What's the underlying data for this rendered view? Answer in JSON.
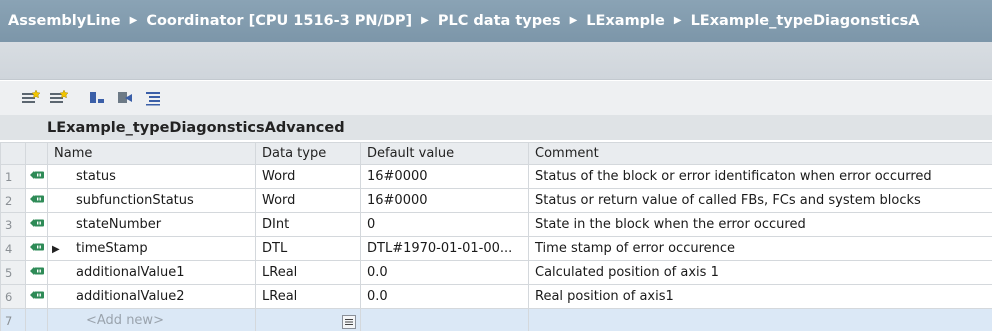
{
  "breadcrumb": {
    "items": [
      "AssemblyLine",
      "Coordinator [CPU 1516-3 PN/DP]",
      "PLC data types",
      "LExample",
      "LExample_typeDiagonsticsA"
    ],
    "separator": "▶"
  },
  "toolbar": {
    "buttons": [
      {
        "icon": "insert-row-icon"
      },
      {
        "icon": "add-row-icon"
      },
      {
        "icon": "expand-all-icon"
      },
      {
        "icon": "collapse-all-icon"
      },
      {
        "icon": "list-view-icon"
      }
    ]
  },
  "struct": {
    "title": "LExample_typeDiagonsticsAdvanced"
  },
  "table": {
    "columns": [
      "Name",
      "Data type",
      "Default value",
      "Comment"
    ],
    "rows": [
      {
        "num": "1",
        "name": "status",
        "type": "Word",
        "default": "16#0000",
        "comment": "Status of the block or error identificaton when error occurred",
        "expandable": false
      },
      {
        "num": "2",
        "name": "subfunctionStatus",
        "type": "Word",
        "default": "16#0000",
        "comment": "Status or return value of called FBs, FCs and system blocks",
        "expandable": false
      },
      {
        "num": "3",
        "name": "stateNumber",
        "type": "DInt",
        "default": "0",
        "comment": "State in the block when the error occured",
        "expandable": false
      },
      {
        "num": "4",
        "name": "timeStamp",
        "type": "DTL",
        "default": "DTL#1970-01-01-00...",
        "comment": "Time stamp of error occurence",
        "expandable": true
      },
      {
        "num": "5",
        "name": "additionalValue1",
        "type": "LReal",
        "default": "0.0",
        "comment": "Calculated position of axis 1",
        "expandable": false
      },
      {
        "num": "6",
        "name": "additionalValue2",
        "type": "LReal",
        "default": "0.0",
        "comment": "Real position of axis1",
        "expandable": false
      }
    ],
    "new_row": {
      "num": "7",
      "placeholder": "<Add new>"
    }
  },
  "colors": {
    "breadcrumb_bg": "#7c96a9",
    "icon_green": "#2e8b57",
    "selection_row": "#dbe8f6"
  }
}
